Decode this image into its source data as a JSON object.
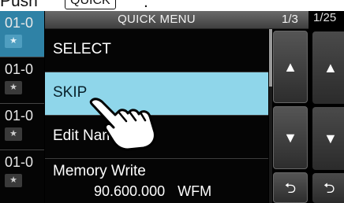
{
  "instruction": {
    "text": "Push",
    "key_label": "QUICK",
    "trailing": "."
  },
  "background_list": {
    "rows": [
      {
        "channel": "01-0",
        "star": "★",
        "selected": true
      },
      {
        "channel": "01-0",
        "star": "★",
        "selected": false
      },
      {
        "channel": "01-0",
        "star": "★",
        "selected": false
      },
      {
        "channel": "01-0",
        "star": "★",
        "selected": false
      }
    ]
  },
  "background_right": {
    "page": "1/25",
    "up_glyph": "▲",
    "down_glyph": "▼",
    "back_glyph": "⮌"
  },
  "quick_menu": {
    "title": "QUICK MENU",
    "page": "1/3",
    "items": [
      {
        "label": "SELECT"
      },
      {
        "label": "SKIP"
      },
      {
        "label": "Edit Name"
      },
      {
        "label": "Memory Write",
        "frequency": "90.600.000",
        "mode": "WFM"
      }
    ],
    "selected_item": "SKIP",
    "scroll_position_fraction": 0.0,
    "buttons": {
      "up_glyph": "▲",
      "down_glyph": "▼",
      "back_glyph": "⮌"
    }
  },
  "colors": {
    "selection": "#8fd6ea",
    "list_selection": "#2f82a6",
    "background": "#000000"
  }
}
